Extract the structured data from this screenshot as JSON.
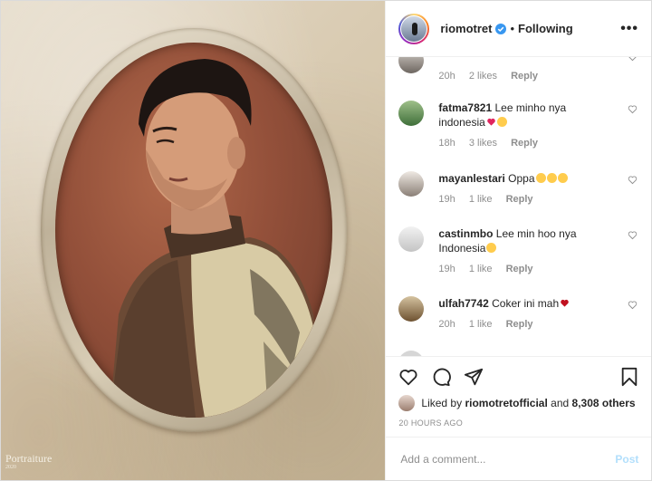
{
  "image": {
    "watermark_title": "Portraiture",
    "watermark_subtitle": "2020"
  },
  "header": {
    "username": "riomotret",
    "separator": "•",
    "follow_label": "Following",
    "more_label": "•••"
  },
  "comments": [
    {
      "user": "",
      "text": "",
      "time": "20h",
      "likes": "2 likes",
      "reply": "Reply"
    },
    {
      "user": "fatma7821",
      "text": "Lee minho nya indonesia",
      "emoji": [
        "heart",
        "smile"
      ],
      "time": "18h",
      "likes": "3 likes",
      "reply": "Reply"
    },
    {
      "user": "mayanlestari",
      "text": "Oppa",
      "emoji": [
        "smile",
        "smile",
        "smile"
      ],
      "time": "19h",
      "likes": "1 like",
      "reply": "Reply"
    },
    {
      "user": "castinmbo",
      "text": "Lee min hoo nya Indonesia",
      "emoji": [
        "smile"
      ],
      "time": "19h",
      "likes": "1 like",
      "reply": "Reply"
    },
    {
      "user": "ulfah7742",
      "text": "Coker ini mah",
      "emoji": [
        "heart"
      ],
      "time": "20h",
      "likes": "1 like",
      "reply": "Reply"
    }
  ],
  "likes": {
    "prefix": "Liked by",
    "user": "riomotretofficial",
    "middle": "and",
    "others": "8,308 others"
  },
  "timestamp": "20 HOURS AGO",
  "add_comment": {
    "placeholder": "Add a comment...",
    "post_label": "Post"
  },
  "colors": {
    "verified": "#3897f0",
    "link_blue_disabled": "#b2dffc",
    "heart_red": "#e0245e"
  },
  "icons": [
    "verified-badge-icon",
    "more-icon",
    "heart-icon",
    "comment-icon",
    "share-icon",
    "bookmark-icon"
  ]
}
